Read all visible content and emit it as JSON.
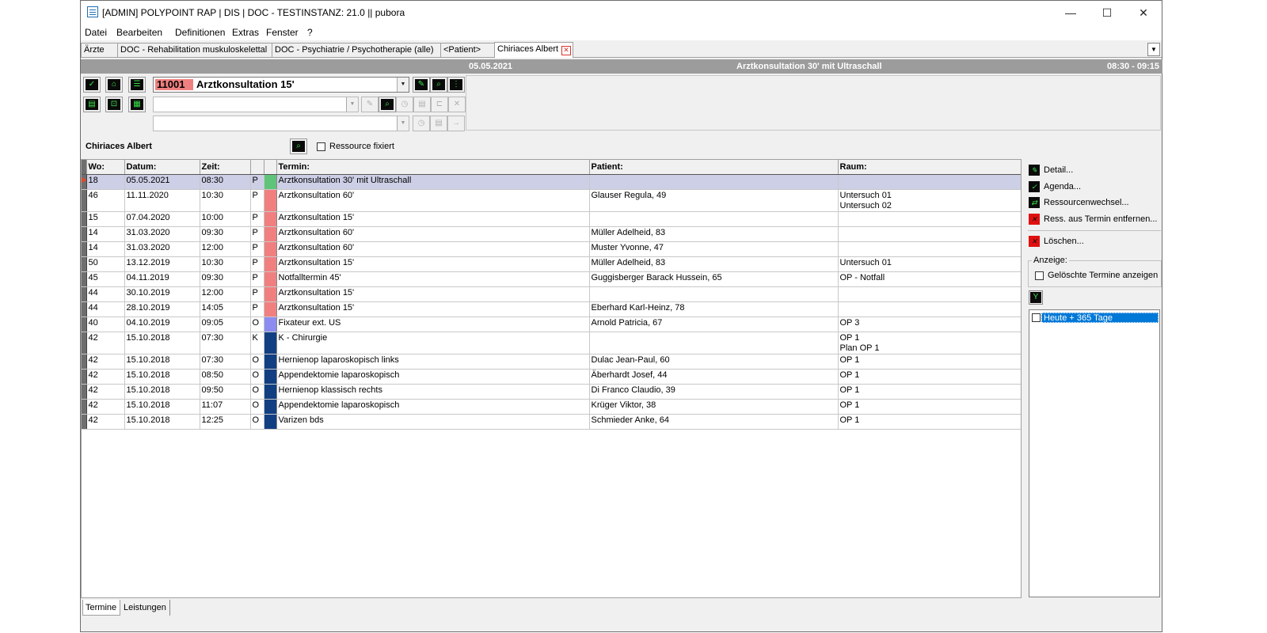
{
  "window": {
    "title": "[ADMIN] POLYPOINT RAP | DIS | DOC - TESTINSTANZ: 21.0 || pubora",
    "minimize": "—",
    "maximize": "☐",
    "close": "✕"
  },
  "menu": [
    "Datei",
    "Bearbeiten",
    "Definitionen",
    "Extras",
    "Fenster",
    "?"
  ],
  "tabs": [
    {
      "label": "Ärzte"
    },
    {
      "label": "DOC - Rehabilitation muskuloskelettal"
    },
    {
      "label": "DOC - Psychiatrie / Psychotherapie (alle)"
    },
    {
      "label": "<Patient>"
    },
    {
      "label": "Chiriaces Albert",
      "active": true,
      "closable": true
    }
  ],
  "info": {
    "date": "05.05.2021",
    "title": "Arztkonsultation 30' mit  Ultraschall",
    "time": "08:30 - 09:15"
  },
  "termin_select": {
    "code": "11001",
    "name": "Arztkonsultation 15'"
  },
  "resource": {
    "name": "Chiriaces Albert",
    "fix_label": "Ressource fixiert",
    "fixed": false
  },
  "table": {
    "columns": [
      "Wo:",
      "Datum:",
      "Zeit:",
      "",
      "",
      "Termin:",
      "Patient:",
      "Raum:"
    ],
    "rows": [
      {
        "wo": "18",
        "datum": "05.05.2021",
        "zeit": "08:30",
        "typ": "P",
        "color": "#5fc47a",
        "termin": "Arztkonsultation 30' mit  Ultraschall",
        "patient": "",
        "raum": "",
        "raum2": "",
        "selected": true
      },
      {
        "wo": "46",
        "datum": "11.11.2020",
        "zeit": "10:30",
        "typ": "P",
        "color": "#f08080",
        "termin": "Arztkonsultation 60'",
        "patient": "Glauser Regula, 49",
        "raum": "Untersuch 01",
        "raum2": "Untersuch 02"
      },
      {
        "wo": "15",
        "datum": "07.04.2020",
        "zeit": "10:00",
        "typ": "P",
        "color": "#f08080",
        "termin": "Arztkonsultation 15'",
        "patient": "",
        "raum": "",
        "raum2": ""
      },
      {
        "wo": "14",
        "datum": "31.03.2020",
        "zeit": "09:30",
        "typ": "P",
        "color": "#f08080",
        "termin": "Arztkonsultation 60'",
        "patient": "Müller Adelheid, 83",
        "raum": "",
        "raum2": ""
      },
      {
        "wo": "14",
        "datum": "31.03.2020",
        "zeit": "12:00",
        "typ": "P",
        "color": "#f08080",
        "termin": "Arztkonsultation 60'",
        "patient": "Muster Yvonne, 47",
        "raum": "",
        "raum2": ""
      },
      {
        "wo": "50",
        "datum": "13.12.2019",
        "zeit": "10:30",
        "typ": "P",
        "color": "#f08080",
        "termin": "Arztkonsultation 15'",
        "patient": "Müller Adelheid, 83",
        "raum": "Untersuch 01",
        "raum2": ""
      },
      {
        "wo": "45",
        "datum": "04.11.2019",
        "zeit": "09:30",
        "typ": "P",
        "color": "#f08080",
        "termin": "Notfalltermin 45'",
        "patient": "Guggisberger Barack Hussein, 65",
        "raum": "OP - Notfall",
        "raum2": ""
      },
      {
        "wo": "44",
        "datum": "30.10.2019",
        "zeit": "12:00",
        "typ": "P",
        "color": "#f08080",
        "termin": "Arztkonsultation 15'",
        "patient": "",
        "raum": "",
        "raum2": ""
      },
      {
        "wo": "44",
        "datum": "28.10.2019",
        "zeit": "14:05",
        "typ": "P",
        "color": "#f08080",
        "termin": "Arztkonsultation 15'",
        "patient": "Eberhard Karl-Heinz, 78",
        "raum": "",
        "raum2": ""
      },
      {
        "wo": "40",
        "datum": "04.10.2019",
        "zeit": "09:05",
        "typ": "O",
        "color": "#8c8cf0",
        "termin": "Fixateur ext. US",
        "patient": "Arnold Patricia, 67",
        "raum": "OP 3",
        "raum2": ""
      },
      {
        "wo": "42",
        "datum": "15.10.2018",
        "zeit": "07:30",
        "typ": "K",
        "color": "#123f82",
        "termin": "K - Chirurgie",
        "patient": "",
        "raum": "OP 1",
        "raum2": "Plan OP 1"
      },
      {
        "wo": "42",
        "datum": "15.10.2018",
        "zeit": "07:30",
        "typ": "O",
        "color": "#123f82",
        "termin": "Hernienop laparoskopisch links",
        "patient": "Dulac Jean-Paul, 60",
        "raum": "OP 1",
        "raum2": ""
      },
      {
        "wo": "42",
        "datum": "15.10.2018",
        "zeit": "08:50",
        "typ": "O",
        "color": "#123f82",
        "termin": "Appendektomie laparoskopisch",
        "patient": "Äberhardt Josef, 44",
        "raum": "OP 1",
        "raum2": ""
      },
      {
        "wo": "42",
        "datum": "15.10.2018",
        "zeit": "09:50",
        "typ": "O",
        "color": "#123f82",
        "termin": "Hernienop klassisch rechts",
        "patient": "Di Franco Claudio, 39",
        "raum": "OP 1",
        "raum2": ""
      },
      {
        "wo": "42",
        "datum": "15.10.2018",
        "zeit": "11:07",
        "typ": "O",
        "color": "#123f82",
        "termin": "Appendektomie laparoskopisch",
        "patient": "Krüger Viktor, 38",
        "raum": "OP 1",
        "raum2": ""
      },
      {
        "wo": "42",
        "datum": "15.10.2018",
        "zeit": "12:25",
        "typ": "O",
        "color": "#123f82",
        "termin": "Varizen bds",
        "patient": "Schmieder Anke, 64",
        "raum": "OP 1",
        "raum2": ""
      }
    ]
  },
  "actions": {
    "detail": "Detail...",
    "agenda": "Agenda...",
    "ressourcenwechsel": "Ressourcenwechsel...",
    "ress_entfernen": "Ress. aus Termin entfernen...",
    "loeschen": "Löschen..."
  },
  "anzeige": {
    "label": "Anzeige:",
    "geloeschte": "Gelöschte Termine anzeigen",
    "filter_item": "Heute + 365 Tage"
  },
  "bottom_tabs": [
    "Termine",
    "Leistungen"
  ]
}
